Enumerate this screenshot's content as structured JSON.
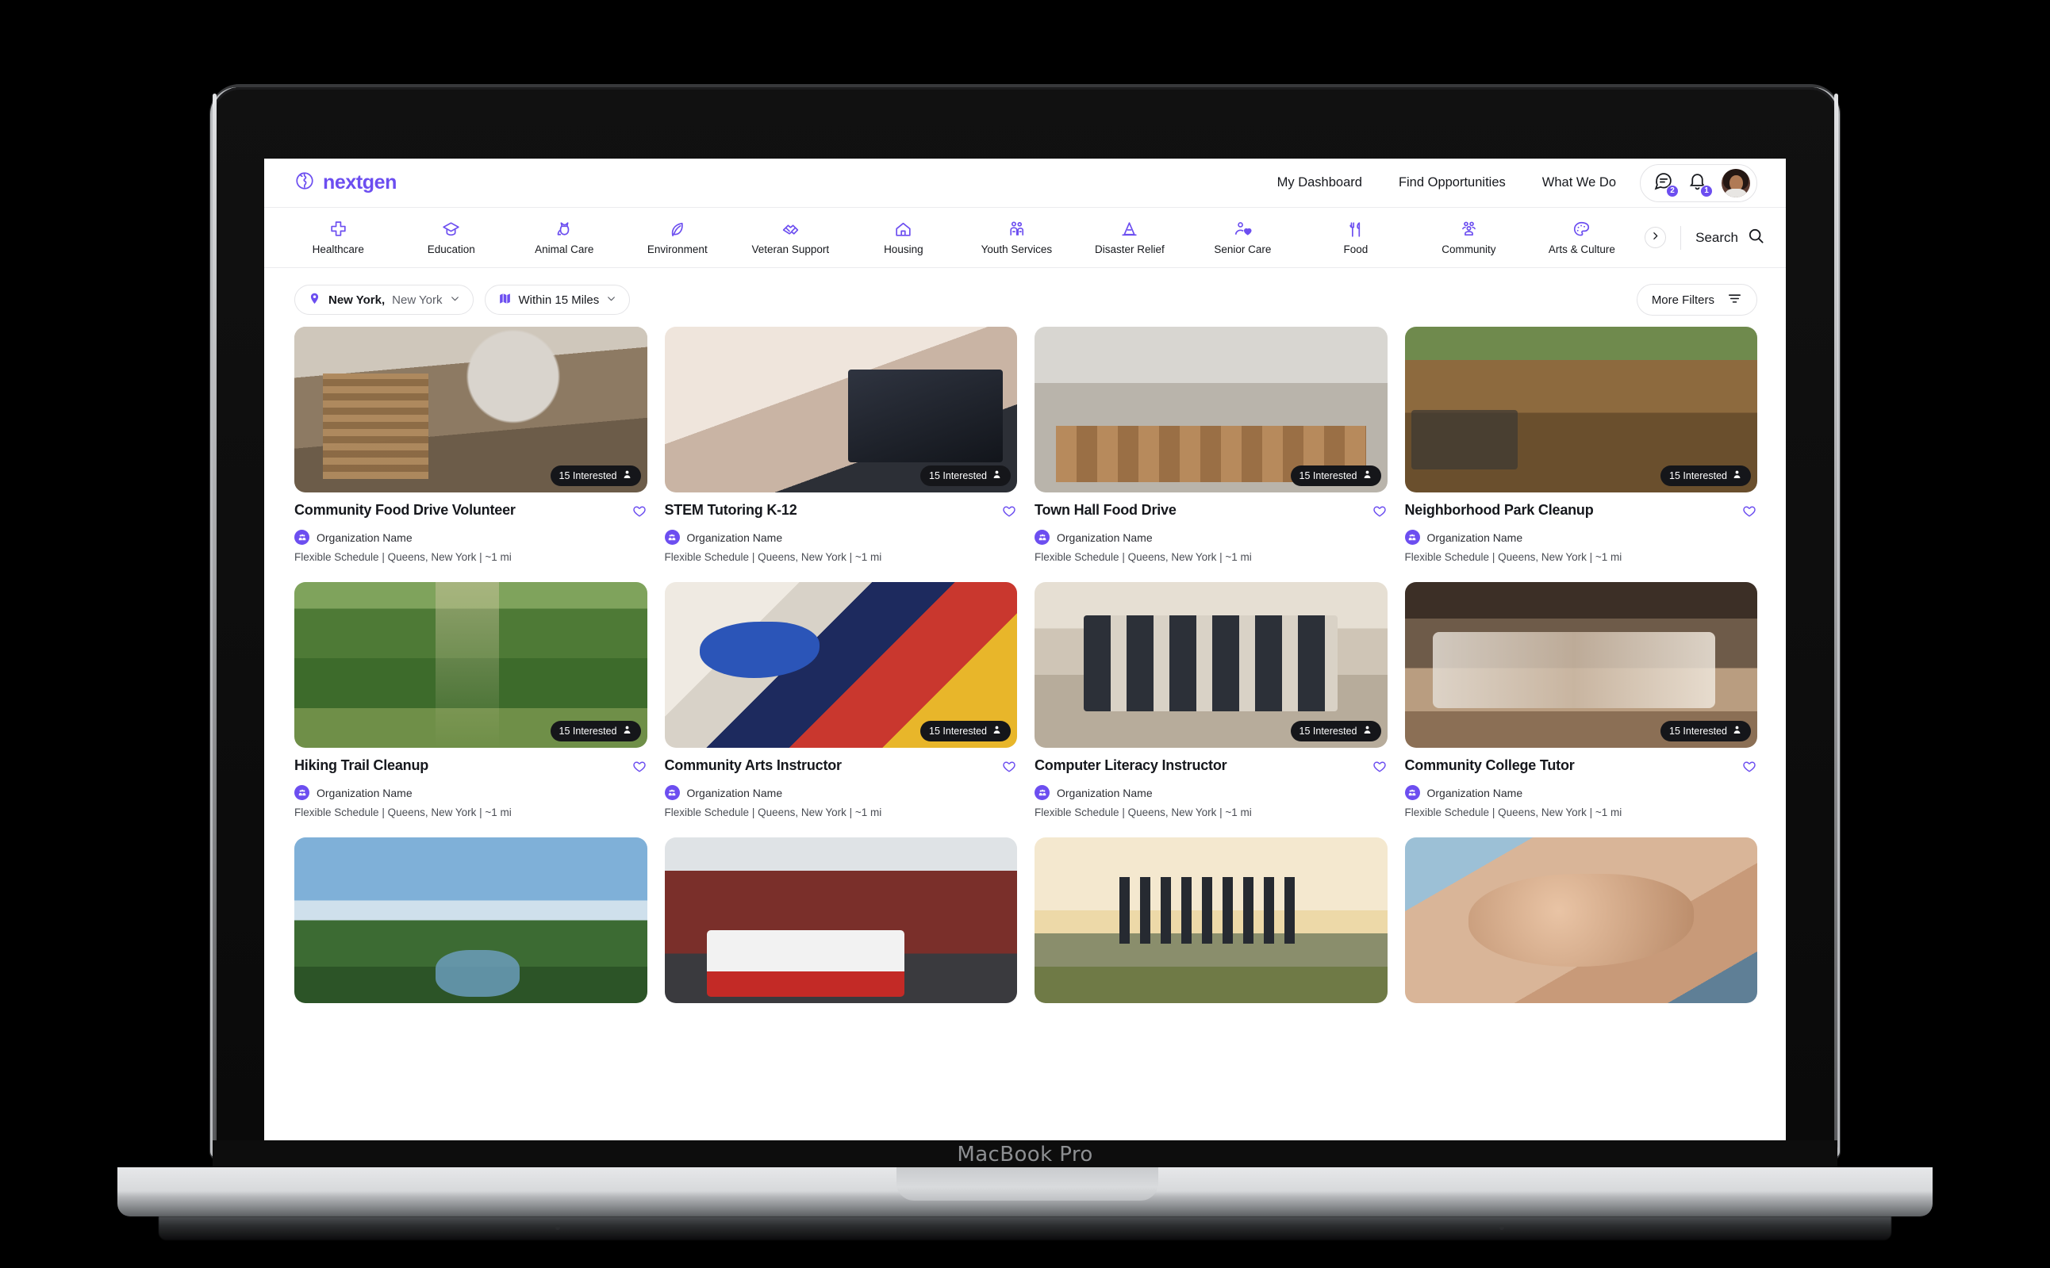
{
  "device": {
    "label": "MacBook Pro"
  },
  "header": {
    "brand": "nextgen",
    "logo_icon": "globe-icon",
    "nav": [
      {
        "label": "My Dashboard"
      },
      {
        "label": "Find Opportunities"
      },
      {
        "label": "What We Do"
      }
    ],
    "messages_icon": "chat-bubble-icon",
    "messages_count": "2",
    "notifications_icon": "bell-icon",
    "notifications_count": "1",
    "avatar_name": "user-avatar"
  },
  "categories": {
    "items": [
      {
        "label": "Healthcare",
        "icon": "medical-cross-icon"
      },
      {
        "label": "Education",
        "icon": "graduation-cap-icon"
      },
      {
        "label": "Animal Care",
        "icon": "cat-icon"
      },
      {
        "label": "Environment",
        "icon": "leaf-icon"
      },
      {
        "label": "Veteran Support",
        "icon": "handshake-icon"
      },
      {
        "label": "Housing",
        "icon": "house-icon"
      },
      {
        "label": "Youth Services",
        "icon": "two-people-icon"
      },
      {
        "label": "Disaster Relief",
        "icon": "traffic-cone-icon"
      },
      {
        "label": "Senior Care",
        "icon": "person-heart-icon"
      },
      {
        "label": "Food",
        "icon": "fork-knife-icon"
      },
      {
        "label": "Community",
        "icon": "people-group-icon"
      },
      {
        "label": "Arts & Culture",
        "icon": "paint-palette-icon"
      }
    ],
    "next_icon": "chevron-right-icon",
    "search_label": "Search",
    "search_icon": "magnifier-icon"
  },
  "filters": {
    "location_icon": "map-pin-icon",
    "location_city": "New York,",
    "location_state": "New York",
    "location_chevron": "chevron-down-icon",
    "distance_icon": "map-fold-icon",
    "distance_label": "Within 15 Miles",
    "distance_chevron": "chevron-down-icon",
    "more_filters_label": "More Filters",
    "more_filters_icon": "sliders-icon"
  },
  "theme": {
    "accent": "#6c4ef0",
    "text": "#16181d",
    "muted": "#4a4d54",
    "badge_bg": "#15161a"
  },
  "cards": [
    {
      "title": "Community Food Drive Volunteer",
      "org": "Organization Name",
      "meta": "Flexible Schedule | Queens, New York | ~1 mi",
      "interested": "15 Interested",
      "photo": "p1",
      "heart": "heart-outline-icon"
    },
    {
      "title": "STEM Tutoring K-12",
      "org": "Organization Name",
      "meta": "Flexible Schedule | Queens, New York | ~1 mi",
      "interested": "15 Interested",
      "photo": "p2",
      "heart": "heart-outline-icon"
    },
    {
      "title": "Town Hall Food Drive",
      "org": "Organization Name",
      "meta": "Flexible Schedule | Queens, New York | ~1 mi",
      "interested": "15 Interested",
      "photo": "p3",
      "heart": "heart-outline-icon"
    },
    {
      "title": "Neighborhood Park Cleanup",
      "org": "Organization Name",
      "meta": "Flexible Schedule | Queens, New York | ~1 mi",
      "interested": "15 Interested",
      "photo": "p4",
      "heart": "heart-outline-icon"
    },
    {
      "title": "Hiking Trail Cleanup",
      "org": "Organization Name",
      "meta": "Flexible Schedule | Queens, New York | ~1 mi",
      "interested": "15 Interested",
      "photo": "p5",
      "heart": "heart-outline-icon"
    },
    {
      "title": "Community Arts Instructor",
      "org": "Organization Name",
      "meta": "Flexible Schedule | Queens, New York | ~1 mi",
      "interested": "15 Interested",
      "photo": "p6",
      "heart": "heart-outline-icon"
    },
    {
      "title": "Computer Literacy Instructor",
      "org": "Organization Name",
      "meta": "Flexible Schedule | Queens, New York | ~1 mi",
      "interested": "15 Interested",
      "photo": "p7",
      "heart": "heart-outline-icon"
    },
    {
      "title": "Community College Tutor",
      "org": "Organization Name",
      "meta": "Flexible Schedule | Queens, New York | ~1 mi",
      "interested": "15 Interested",
      "photo": "p8",
      "heart": "heart-outline-icon"
    }
  ],
  "cards_partial": [
    {
      "photo": "p9"
    },
    {
      "photo": "p10"
    },
    {
      "photo": "p11"
    },
    {
      "photo": "p12"
    }
  ]
}
